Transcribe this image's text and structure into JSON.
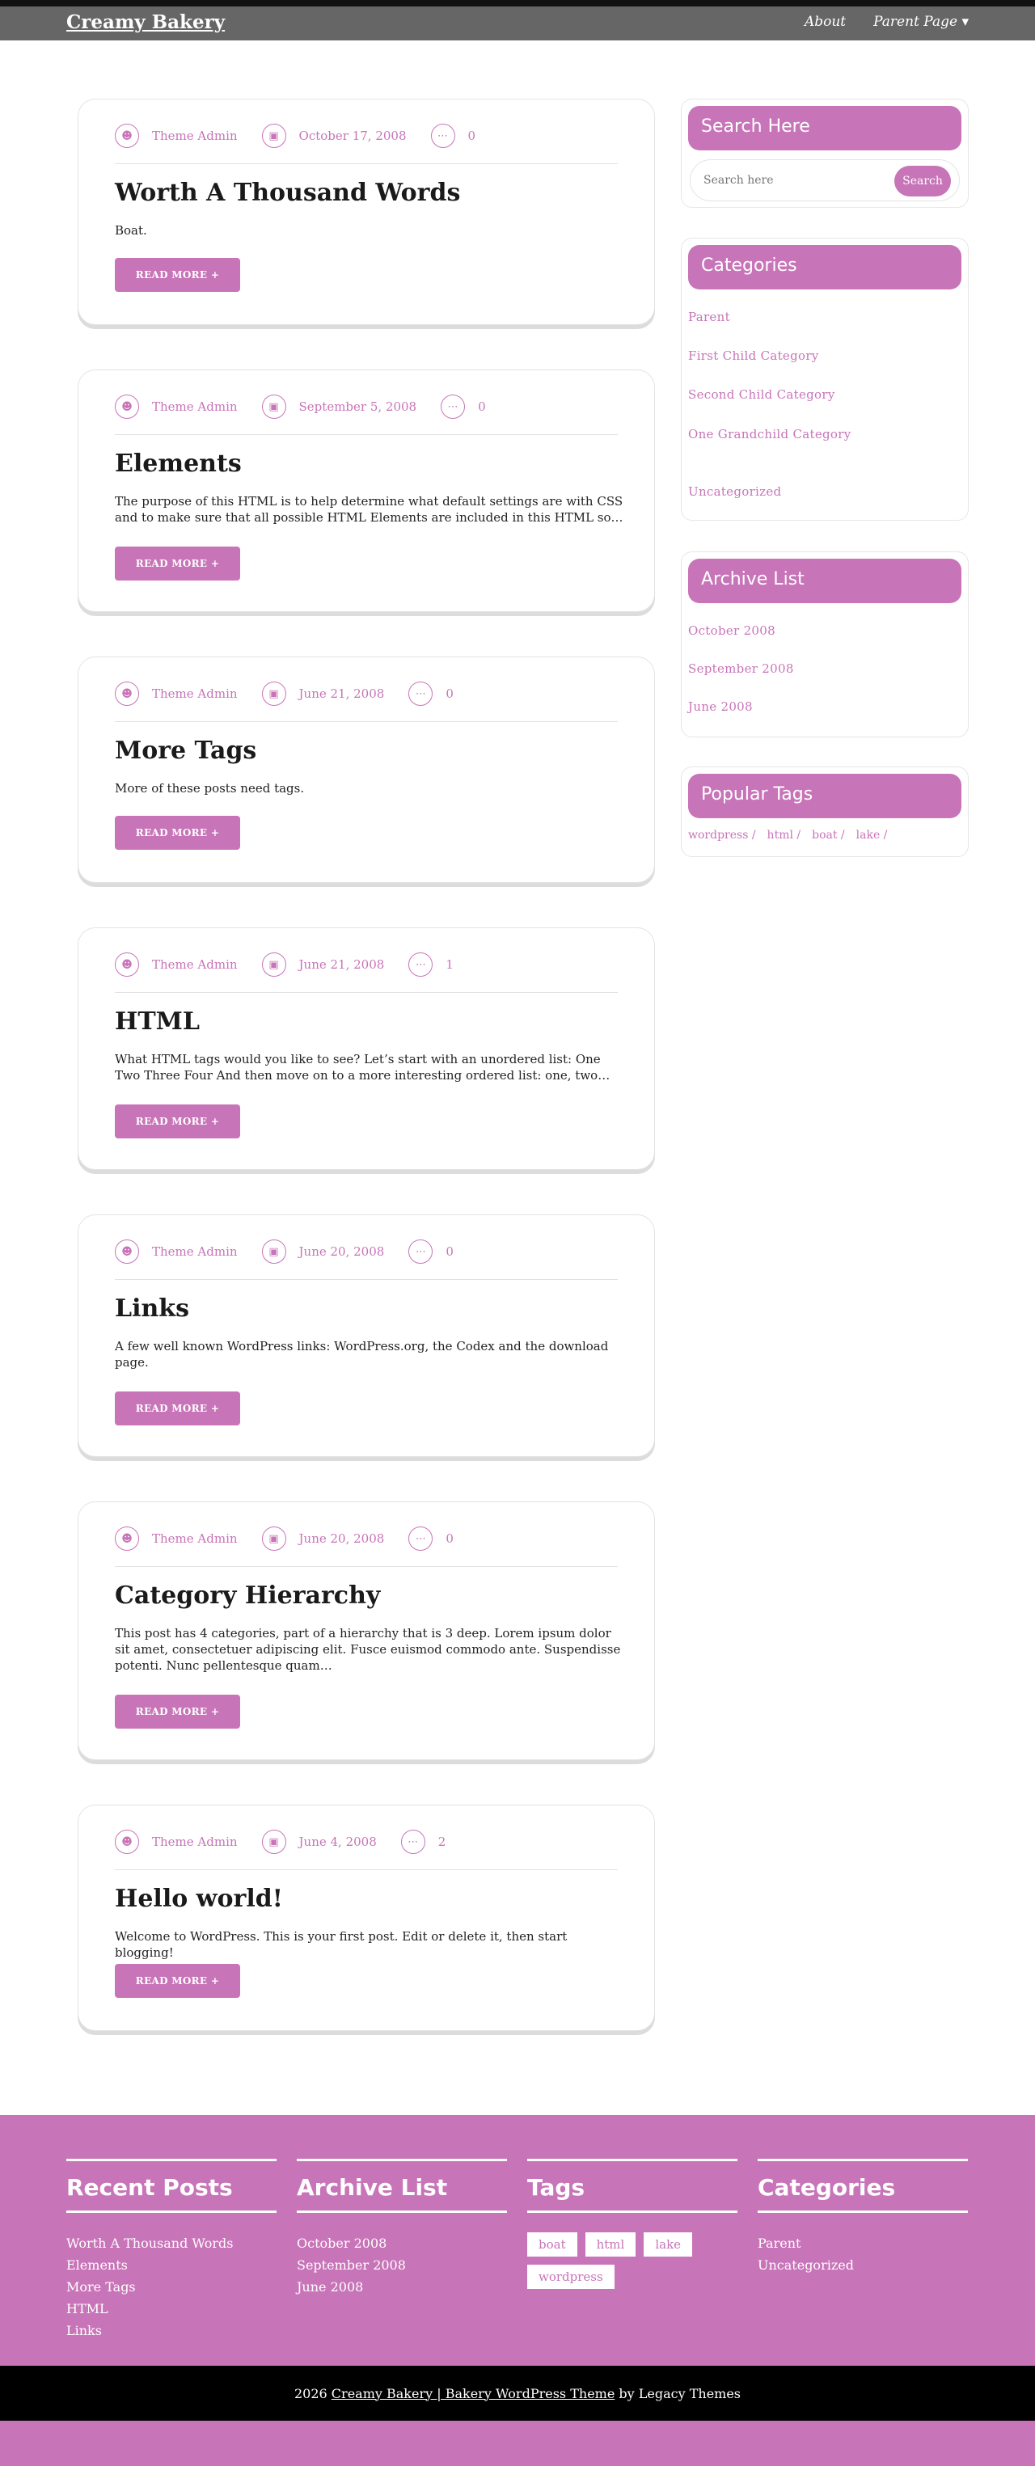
{
  "header": {
    "brand": "Creamy Bakery",
    "nav": [
      "About",
      "Parent Page ▾"
    ]
  },
  "meta_icons": [
    "user-icon",
    "calendar-icon",
    "comment-icon"
  ],
  "posts": [
    {
      "author": "Theme Admin",
      "date": "October 17, 2008",
      "comments": "0",
      "title": "Worth A Thousand Words",
      "excerpt": "Boat.",
      "read_more": "READ MORE +"
    },
    {
      "author": "Theme Admin",
      "date": "September 5, 2008",
      "comments": "0",
      "title": "Elements",
      "excerpt": "The purpose of this HTML is to help determine what default settings are with CSS and to make sure that all possible HTML Elements are included in this HTML so…",
      "read_more": "READ MORE +"
    },
    {
      "author": "Theme Admin",
      "date": "June 21, 2008",
      "comments": "0",
      "title": "More Tags",
      "excerpt": "More of these posts need tags.",
      "read_more": "READ MORE +"
    },
    {
      "author": "Theme Admin",
      "date": "June 21, 2008",
      "comments": "1",
      "title": "HTML",
      "excerpt": "What HTML tags would you like to see? Let’s start with an unordered list: One Two Three Four And then move on to a more interesting ordered list: one, two…",
      "read_more": "READ MORE +"
    },
    {
      "author": "Theme Admin",
      "date": "June 20, 2008",
      "comments": "0",
      "title": "Links",
      "excerpt": "A few well known WordPress links: WordPress.org, the Codex and the download page.",
      "read_more": "READ MORE +"
    },
    {
      "author": "Theme Admin",
      "date": "June 20, 2008",
      "comments": "0",
      "title": "Category Hierarchy",
      "excerpt": "This post has 4 categories, part of a hierarchy that is 3 deep. Lorem ipsum dolor sit amet, consectetuer adipiscing elit. Fusce euismod commodo ante. Suspendisse potenti. Nunc pellentesque quam…",
      "read_more": "READ MORE +"
    },
    {
      "author": "Theme Admin",
      "date": "June 4, 2008",
      "comments": "2",
      "title": "Hello world!",
      "excerpt": "Welcome to WordPress. This is your first post. Edit or delete it, then start blogging!",
      "read_more": "READ MORE +"
    }
  ],
  "sidebar": {
    "search": {
      "title": "Search Here",
      "placeholder": "Search here",
      "button": "Search"
    },
    "categories": {
      "title": "Categories",
      "items": [
        "Parent",
        "First Child Category",
        "Second Child Category",
        "One Grandchild Category",
        "Uncategorized"
      ]
    },
    "archive": {
      "title": "Archive List",
      "items": [
        "October 2008",
        "September 2008",
        "June 2008"
      ]
    },
    "tags": {
      "title": "Popular Tags",
      "items": [
        "wordpress /",
        "html /",
        "boat /",
        "lake /"
      ]
    }
  },
  "footer": {
    "recent": {
      "title": "Recent Posts",
      "items": [
        "Worth A Thousand Words",
        "Elements",
        "More Tags",
        "HTML",
        "Links"
      ]
    },
    "archive": {
      "title": "Archive List",
      "items": [
        "October 2008",
        "September 2008",
        "June 2008"
      ]
    },
    "tags": {
      "title": "Tags",
      "items": [
        "boat",
        "html",
        "lake",
        "wordpress"
      ]
    },
    "categories": {
      "title": "Categories",
      "items": [
        "Parent",
        "Uncategorized"
      ]
    },
    "copyright": {
      "prefix": "2026",
      "link": "Creamy Bakery | Bakery WordPress Theme",
      "suffix": "by Legacy Themes"
    }
  },
  "colors": {
    "accent": "#c874b8",
    "header": "#666666",
    "bottom_bar": "#000000"
  }
}
